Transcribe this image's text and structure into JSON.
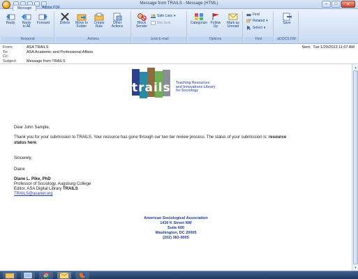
{
  "window": {
    "title": "Message from TRAILS - Message (HTML)",
    "min": "–",
    "max": "□",
    "close": "✕"
  },
  "tabs": [
    {
      "label": "Message"
    },
    {
      "label": "Adobe PDF"
    }
  ],
  "ribbon": {
    "groups": {
      "respond": "Respond",
      "actions": "Actions",
      "junk": "Junk E-mail",
      "options": "Options",
      "find": "Find",
      "adocs": "aDOCS DM"
    },
    "buttons": {
      "reply": "Reply",
      "reply_all_1": "Reply",
      "reply_all_2": "to All",
      "forward": "Forward",
      "delete": "Delete",
      "move_1": "Move to",
      "move_2": "Folder",
      "create_1": "Create",
      "create_2": "Rule",
      "other_1": "Other",
      "other_2": "Actions",
      "block_1": "Block",
      "block_2": "Sender",
      "safe_lists": "Safe Lists",
      "not_junk": "Not Junk",
      "categorize": "Categorize",
      "follow_1": "Follow",
      "follow_2": "Up",
      "mark_1": "Mark as",
      "mark_2": "Unread",
      "find": "Find",
      "related": "Related",
      "select": "Select",
      "save": "Save"
    }
  },
  "header": {
    "from_label": "From:",
    "from": "ASA TRAILS",
    "to_label": "To:",
    "to": "ASA Academic and Professional Affairs",
    "cc_label": "Cc:",
    "cc": "",
    "subject_label": "Subject:",
    "subject": "Message from TRAILS",
    "sent_label": "Sent:",
    "sent": "Tue 1/29/2013 11:07 AM"
  },
  "logo": {
    "word": "trails",
    "tag_1": "Teaching Resources",
    "tag_2": "and Innovations Library",
    "tag_3": "for Sociology",
    "colors": [
      "#2e3f8f",
      "#2a8aa6",
      "#8c6d3f",
      "#6fae54",
      "#8a8f96"
    ]
  },
  "message": {
    "greeting": "Dear John Sample,",
    "line1": "Thank you for your submission to TRAILS.  Your resource has gone through our two tier review process. The status of your submission is: ",
    "status_1": "resource",
    "status_2": "status here",
    "status_end": ".",
    "sincerely": "Sincerely,",
    "first_name": "Diane",
    "sig_name": "Diane L. Pike, PhD",
    "sig_title": "Professor of Sociology, Augsburg College",
    "sig_editor": "Editor, ASA Digital Library ",
    "sig_trails": "TRAILS",
    "sig_email": "TRAILS@asanet.org"
  },
  "address": {
    "org": "American Sociological Association",
    "street": "1430 K Street NW",
    "suite": "Suite 600",
    "city": "Washington, DC 20005",
    "phone": "(202) 383-9005"
  },
  "colors": {
    "link": "#1f3aa8",
    "address": "#1f3a8c",
    "ribbon": "#d6e4f5"
  }
}
